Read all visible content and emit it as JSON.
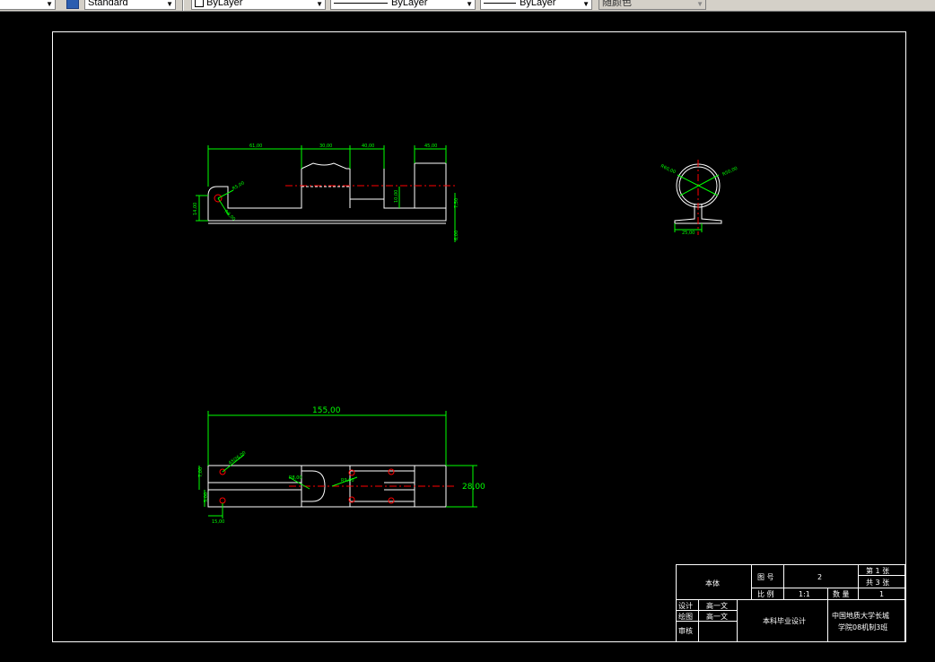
{
  "toolbar": {
    "items": [
      {
        "name": "first-dropdown",
        "label": ""
      },
      {
        "name": "text-style",
        "label": "Standard"
      },
      {
        "name": "layer",
        "label": "ByLayer"
      },
      {
        "name": "linetype",
        "label": "ByLayer"
      },
      {
        "name": "lineweight",
        "label": "ByLayer"
      },
      {
        "name": "plot-style",
        "label": "随颜色"
      }
    ]
  },
  "colors": {
    "background": "#000000",
    "geometry": "#ffffff",
    "dimension": "#00ff00",
    "centerline": "#ff0000",
    "toolbar": "#d4d0c8"
  },
  "drawing": {
    "front_view": {
      "dims": {
        "d1": "61,00",
        "d2": "30,00",
        "d3": "40,00",
        "d4": "45,00",
        "d5": "14,00",
        "d6": "10,00",
        "d7": "R5,00",
        "d8": "R6,00",
        "d9": "7,50",
        "d10": "6,00",
        "d11": "3,50"
      }
    },
    "side_view": {
      "dims": {
        "r1": "R60,00",
        "r2": "R50,00",
        "w": "25,00"
      }
    },
    "top_view": {
      "dims": {
        "length": "155,00",
        "width": "28,00",
        "hole": "4X∅6,00",
        "slot1": "R8,00",
        "slot2": "R9,00",
        "t1": "7,00",
        "t2": "5,00",
        "t3": "15,00"
      }
    },
    "title_block": {
      "part_name": "本体",
      "drawing_no_label": "图 号",
      "drawing_no": "2",
      "sheet_label": "第 1 张",
      "total_label": "共 3 张",
      "scale_label": "比 例",
      "scale": "1:1",
      "qty_label": "数 量",
      "qty": "1",
      "design_label": "设计",
      "design_name": "高一文",
      "draw_label": "绘图",
      "draw_name": "高一文",
      "review_label": "审核",
      "project": "本科毕业设计",
      "school": "中国地质大学长城",
      "class_name": "学院08机制3班"
    }
  }
}
